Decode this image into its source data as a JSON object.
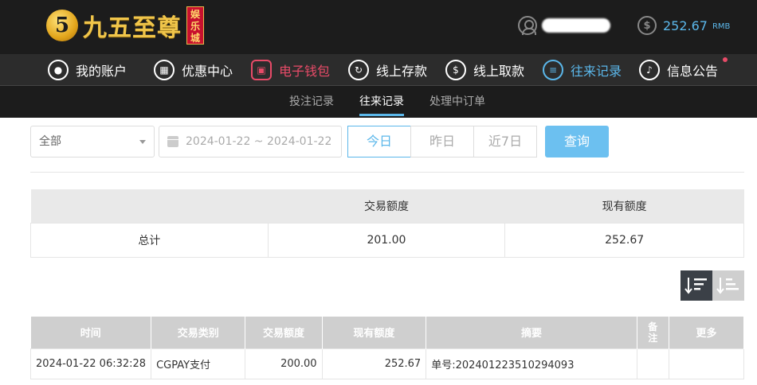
{
  "header": {
    "logo_glyph": "5",
    "logo_text": "九五至尊",
    "logo_sub": "娱乐城",
    "balance": "252.67",
    "currency": "RMB"
  },
  "nav": {
    "items": [
      {
        "label": "我的账户",
        "icon": "user-icon"
      },
      {
        "label": "优惠中心",
        "icon": "gift-icon"
      },
      {
        "label": "电子钱包",
        "icon": "wallet-icon"
      },
      {
        "label": "线上存款",
        "icon": "deposit-icon"
      },
      {
        "label": "线上取款",
        "icon": "withdraw-icon"
      },
      {
        "label": "往来记录",
        "icon": "records-icon"
      },
      {
        "label": "信息公告",
        "icon": "bell-icon"
      }
    ]
  },
  "subnav": {
    "items": [
      "投注记录",
      "往来记录",
      "处理中订单"
    ]
  },
  "filters": {
    "type_selected": "全部",
    "date_range": "2024-01-22 ~ 2024-01-22",
    "quick": [
      "今日",
      "昨日",
      "近7日"
    ],
    "search_label": "查询"
  },
  "summary": {
    "headers": [
      "",
      "交易额度",
      "现有额度"
    ],
    "row": [
      "总计",
      "201.00",
      "252.67"
    ]
  },
  "records": {
    "headers": [
      "时间",
      "交易类别",
      "交易额度",
      "现有额度",
      "摘要",
      "备注",
      "更多"
    ],
    "rows": [
      [
        "2024-01-22 06:32:28",
        "CGPAY支付",
        "200.00",
        "252.67",
        "单号:202401223510294093",
        "",
        ""
      ]
    ]
  }
}
